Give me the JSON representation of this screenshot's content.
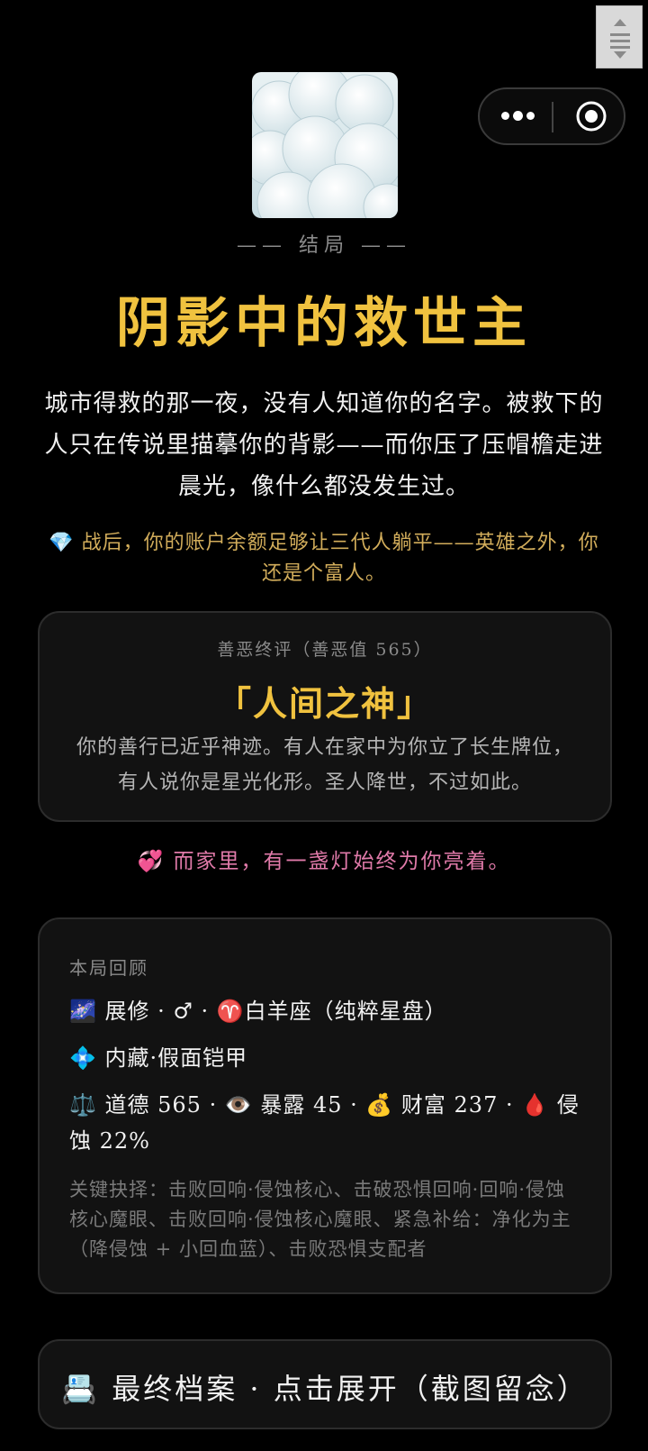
{
  "capsule": {
    "more_icon": "more-dots-icon",
    "close_icon": "target-circle-icon"
  },
  "ending": {
    "tag": "—— 结局 ——",
    "title": "阴影中的救世主",
    "narrative": "城市得救的那一夜，没有人知道你的名字。被救下的人只在传说里描摹你的背影——而你压了压帽檐走进晨光，像什么都没发生过。",
    "wealth_note": "💎 战后，你的账户余额足够让三代人躺平——英雄之外，你还是个富人。"
  },
  "verdict": {
    "label": "善恶终评（善恶值 565）",
    "name": "「人间之神」",
    "description": "你的善行已近乎神迹。有人在家中为你立了长生牌位，有人说你是星光化形。圣人降世，不过如此。"
  },
  "family_note": "💞 而家里，有一盏灯始终为你亮着。",
  "review": {
    "label": "本局回顾",
    "identity": "🌌 展修 · ♂ · ♈白羊座（纯粹星盘）",
    "talent": "💠 内藏·假面铠甲",
    "stats": "⚖️ 道德 565 · 👁️ 暴露 45 · 💰 财富 237 · 🩸 侵蚀 22%",
    "key_choices": "关键抉择：击败回响·侵蚀核心、击破恐惧回响·回响·侵蚀核心魔眼、击败回响·侵蚀核心魔眼、紧急补给：净化为主（降侵蚀 + 小回血蓝）、击败恐惧支配者"
  },
  "final_button": {
    "label": "📇 最终档案 · 点击展开（截图留念）"
  }
}
